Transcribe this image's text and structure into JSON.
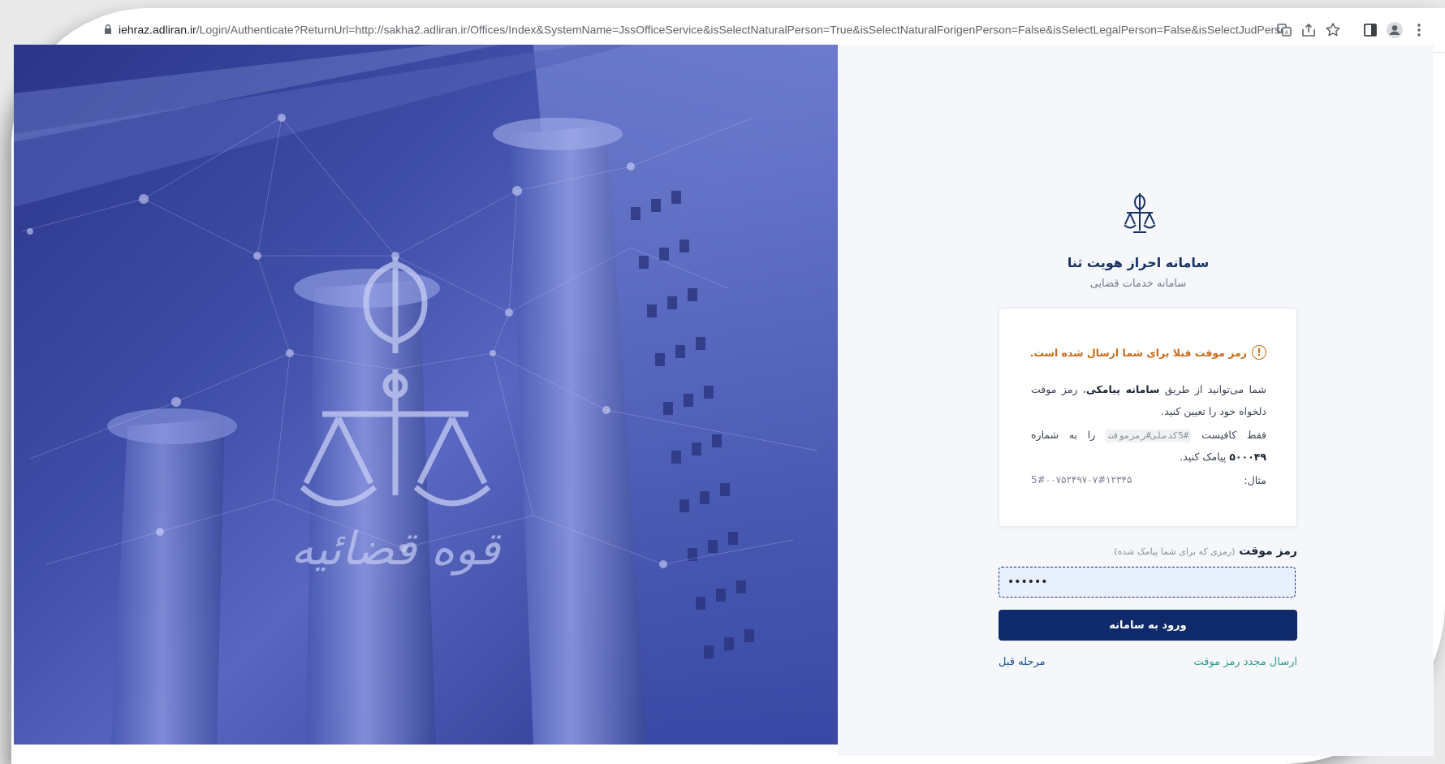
{
  "browser": {
    "url_domain": "iehraz.adliran.ir",
    "url_path": "/Login/Authenticate?ReturnUrl=http://sakha2.adliran.ir/Offices/Index&SystemName=JssOfficeService&isSelectNaturalPerson=True&isSelectNaturalForigenPerson=False&isSelectLegalPerson=False&isSelectJudPerson=False&LoginTitle=...سا",
    "icons": [
      "lock-icon",
      "translate-icon",
      "share-icon",
      "star-icon",
      "side-panel-icon",
      "profile-icon",
      "menu-icon"
    ]
  },
  "hero": {
    "emblem_text": "قوه قضائیه"
  },
  "header": {
    "title": "سامانه احراز هویت ثنا",
    "subtitle": "سامانه خدمات قضایی"
  },
  "card": {
    "warning": "رمز موقت قبلا برای شما ارسال شده است.",
    "para1_a": "شما می‌توانید از طریق ",
    "para1_b": "سامانه پیامکی",
    "para1_c": "، رمز موقت دلخواه خود را تعیین کنید.",
    "para2_a": "فقط کافیست ",
    "para2_code": "5#کدملی#رمزموقت",
    "para2_b": " را به شماره ",
    "para2_number": "۵۰۰۰۴۹",
    "para2_c": " پیامک کنید.",
    "example_label": "مثال:",
    "example_value": "5#۰۰۷۵۲۴۹۷۰۷#۱۲۳۴۵"
  },
  "form": {
    "password_label": "رمز موقت",
    "password_hint": "(رمزی که برای شما پیامک شده)",
    "password_value": "••••••",
    "submit_label": "ورود به سامانه",
    "resend_label": "ارسال مجدد رمز موقت",
    "back_label": "مرحله قبل"
  },
  "colors": {
    "primary": "#0e2a6b",
    "warning": "#c96b18",
    "link": "#2e9a8c",
    "hero": "#3f4ea8"
  }
}
